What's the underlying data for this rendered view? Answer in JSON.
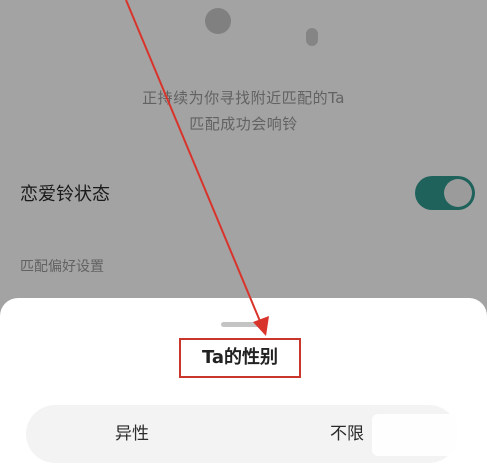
{
  "background": {
    "matching_line1": "正持续为你寻找附近匹配的Ta",
    "matching_line2": "匹配成功会响铃",
    "love_bell_status_label": "恋爱铃状态",
    "love_bell_enabled": true,
    "match_preference_label": "匹配偏好设置"
  },
  "sheet": {
    "title": "Ta的性别",
    "options": [
      {
        "label": "异性"
      },
      {
        "label": "不限"
      }
    ]
  },
  "colors": {
    "toggle_on": "#2f9a8f",
    "annotation_red": "#d9342b"
  }
}
